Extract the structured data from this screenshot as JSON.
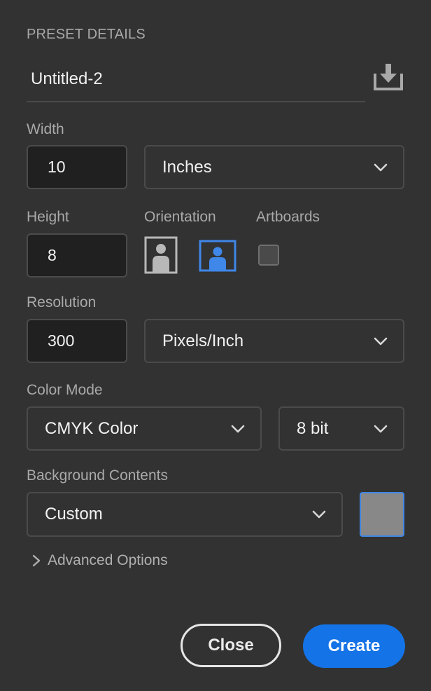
{
  "header": {
    "section_title": "PRESET DETAILS",
    "preset_name": "Untitled-2"
  },
  "width": {
    "label": "Width",
    "value": "10",
    "unit": "Inches"
  },
  "height": {
    "label": "Height",
    "value": "8"
  },
  "orientation": {
    "label": "Orientation",
    "selected": "landscape"
  },
  "artboards": {
    "label": "Artboards",
    "checked": false
  },
  "resolution": {
    "label": "Resolution",
    "value": "300",
    "unit": "Pixels/Inch"
  },
  "color_mode": {
    "label": "Color Mode",
    "mode": "CMYK Color",
    "depth": "8 bit"
  },
  "background": {
    "label": "Background Contents",
    "value": "Custom",
    "swatch_color": "#888888"
  },
  "advanced": {
    "label": "Advanced Options"
  },
  "buttons": {
    "close_label": "Close",
    "create_label": "Create"
  },
  "colors": {
    "panel_bg": "#323232",
    "field_bg": "#202020",
    "accent": "#1473e6",
    "selected_outline": "#3f87e8"
  }
}
